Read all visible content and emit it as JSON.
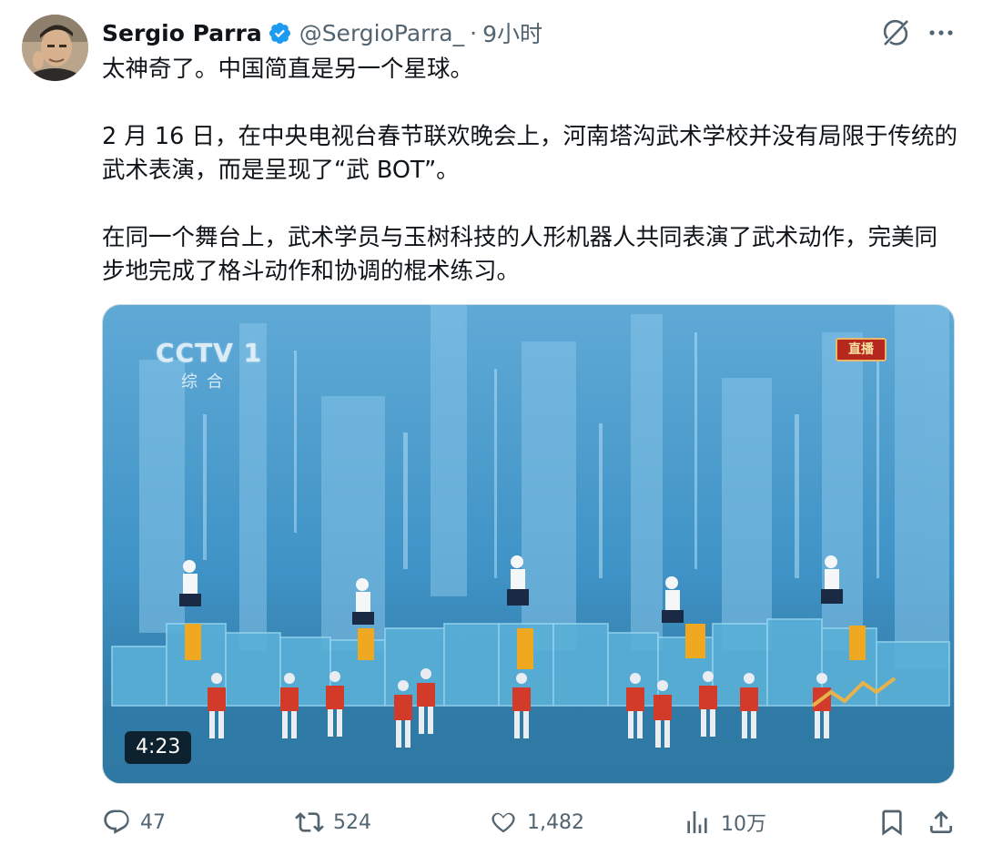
{
  "author": {
    "name": "Sergio Parra",
    "handle": "@SergioParra_",
    "separator": "·",
    "time": "9小时"
  },
  "icons": {
    "verified": "verified-badge-icon",
    "grok": "grok-icon",
    "more": "more-options-icon",
    "reply": "reply-icon",
    "retweet": "retweet-icon",
    "like": "like-icon",
    "views": "views-icon",
    "bookmark": "bookmark-icon",
    "share": "share-icon"
  },
  "tweet": {
    "paragraph1": "太神奇了。中国简直是另一个星球。",
    "paragraph2": "2 月 16 日，在中央电视台春节联欢晚会上，河南塔沟武术学校并没有局限于传统的武术表演，而是呈现了“武 BOT”。",
    "paragraph3": "在同一个舞台上，武术学员与玉树科技的人形机器人共同表演了武术动作，完美同步地完成了格斗动作和协调的棍术练习。"
  },
  "media": {
    "duration": "4:23",
    "channel_logo": "CCTV 1",
    "channel_sub": "综合",
    "live_badge": "直播"
  },
  "stats": {
    "replies": "47",
    "retweets": "524",
    "likes": "1,482",
    "views": "10万"
  },
  "colors": {
    "verified_blue": "#1d9bf0",
    "secondary_text": "#536471",
    "primary_text": "#0f1419"
  }
}
